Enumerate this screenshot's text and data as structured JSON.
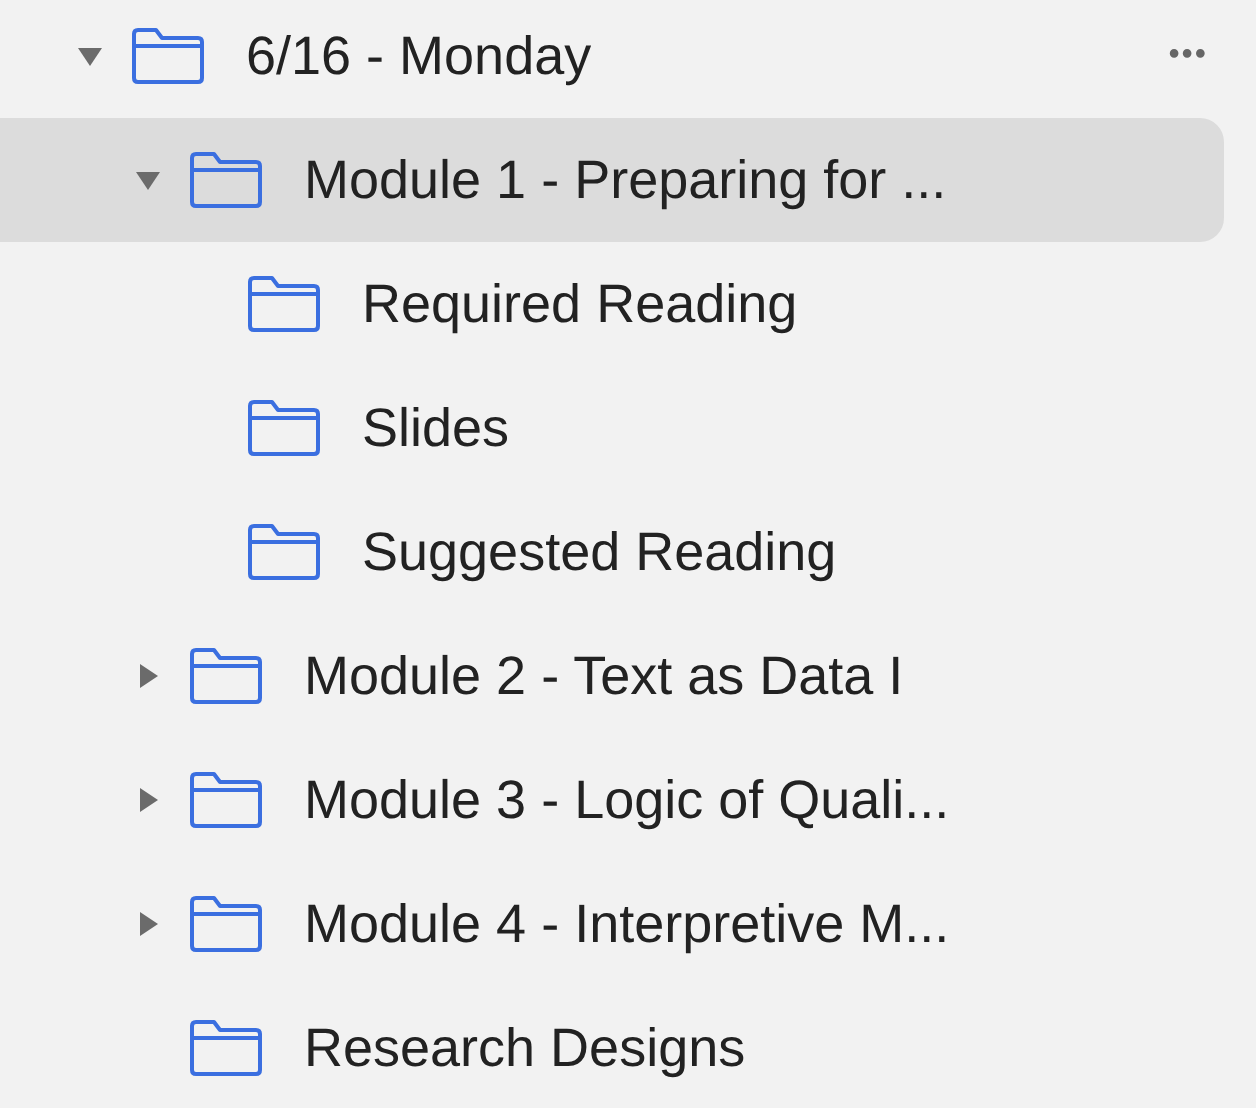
{
  "tree": [
    {
      "label": "6/16 - Monday",
      "expanded": true,
      "selected": false,
      "more": "•••",
      "children": [
        {
          "label": "Module 1 - Preparing for ...",
          "expanded": true,
          "selected": true,
          "children": [
            {
              "label": "Required Reading",
              "selected": false
            },
            {
              "label": "Slides",
              "selected": false
            },
            {
              "label": "Suggested Reading",
              "selected": false
            }
          ]
        },
        {
          "label": "Module 2 - Text as Data I",
          "expanded": false,
          "selected": false
        },
        {
          "label": "Module 3 - Logic of Quali...",
          "expanded": false,
          "selected": false
        },
        {
          "label": "Module 4 - Interpretive M...",
          "expanded": false,
          "selected": false
        },
        {
          "label": "Research Designs",
          "selected": false
        }
      ]
    }
  ]
}
